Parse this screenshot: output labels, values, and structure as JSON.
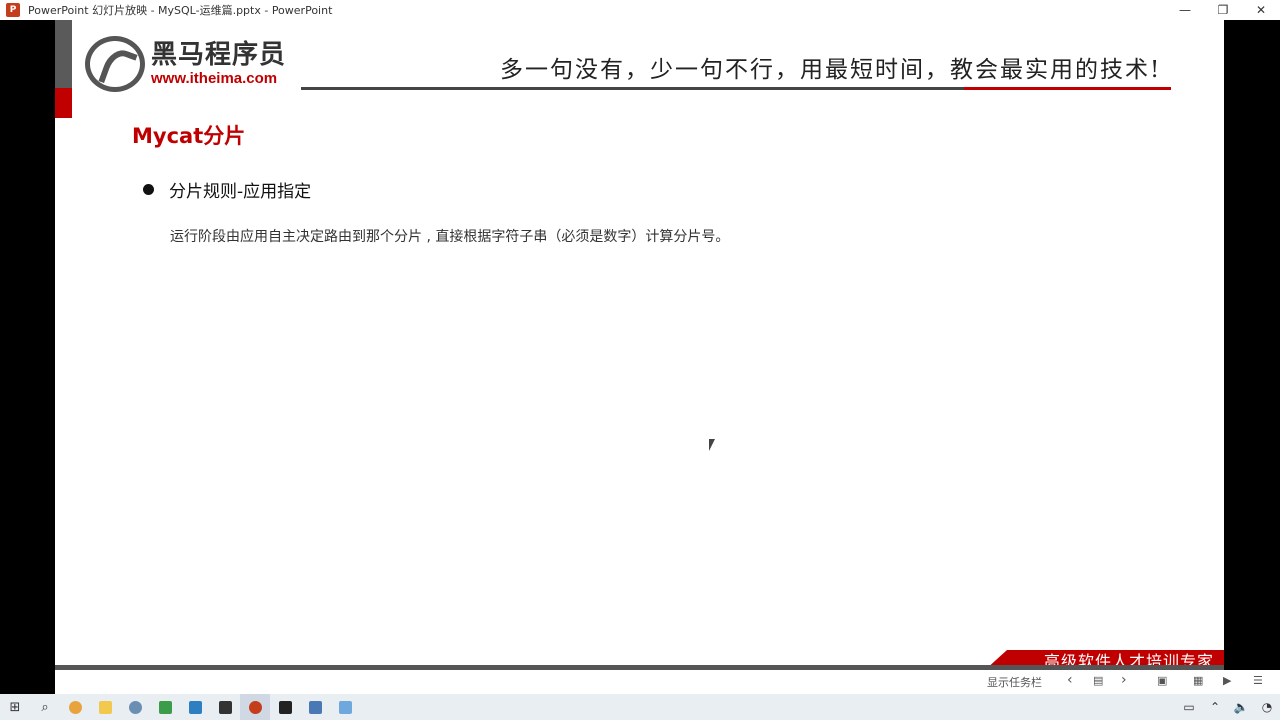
{
  "window": {
    "title": "PowerPoint 幻灯片放映 - MySQL-运维篇.pptx - PowerPoint",
    "app_icon": "P",
    "minimize_glyph": "—",
    "maximize_glyph": "❐",
    "close_glyph": "✕"
  },
  "slide": {
    "logo_cn": "黑马程序员",
    "logo_url": "www.itheima.com",
    "slogan": "多一句没有，少一句不行，用最短时间，教会最实用的技术!",
    "title": "Mycat分片",
    "bullet": "分片规则-应用指定",
    "description": "运行阶段由应用自主决定路由到那个分片 , 直接根据字符子串（必须是数字）计算分片号。",
    "footer_banner": "高级软件人才培训专家"
  },
  "presenter": {
    "show_taskbar": "显示任务栏",
    "prev": "‹",
    "next": "›"
  },
  "colors": {
    "brand_red": "#c00000",
    "dark_gray": "#555555"
  }
}
